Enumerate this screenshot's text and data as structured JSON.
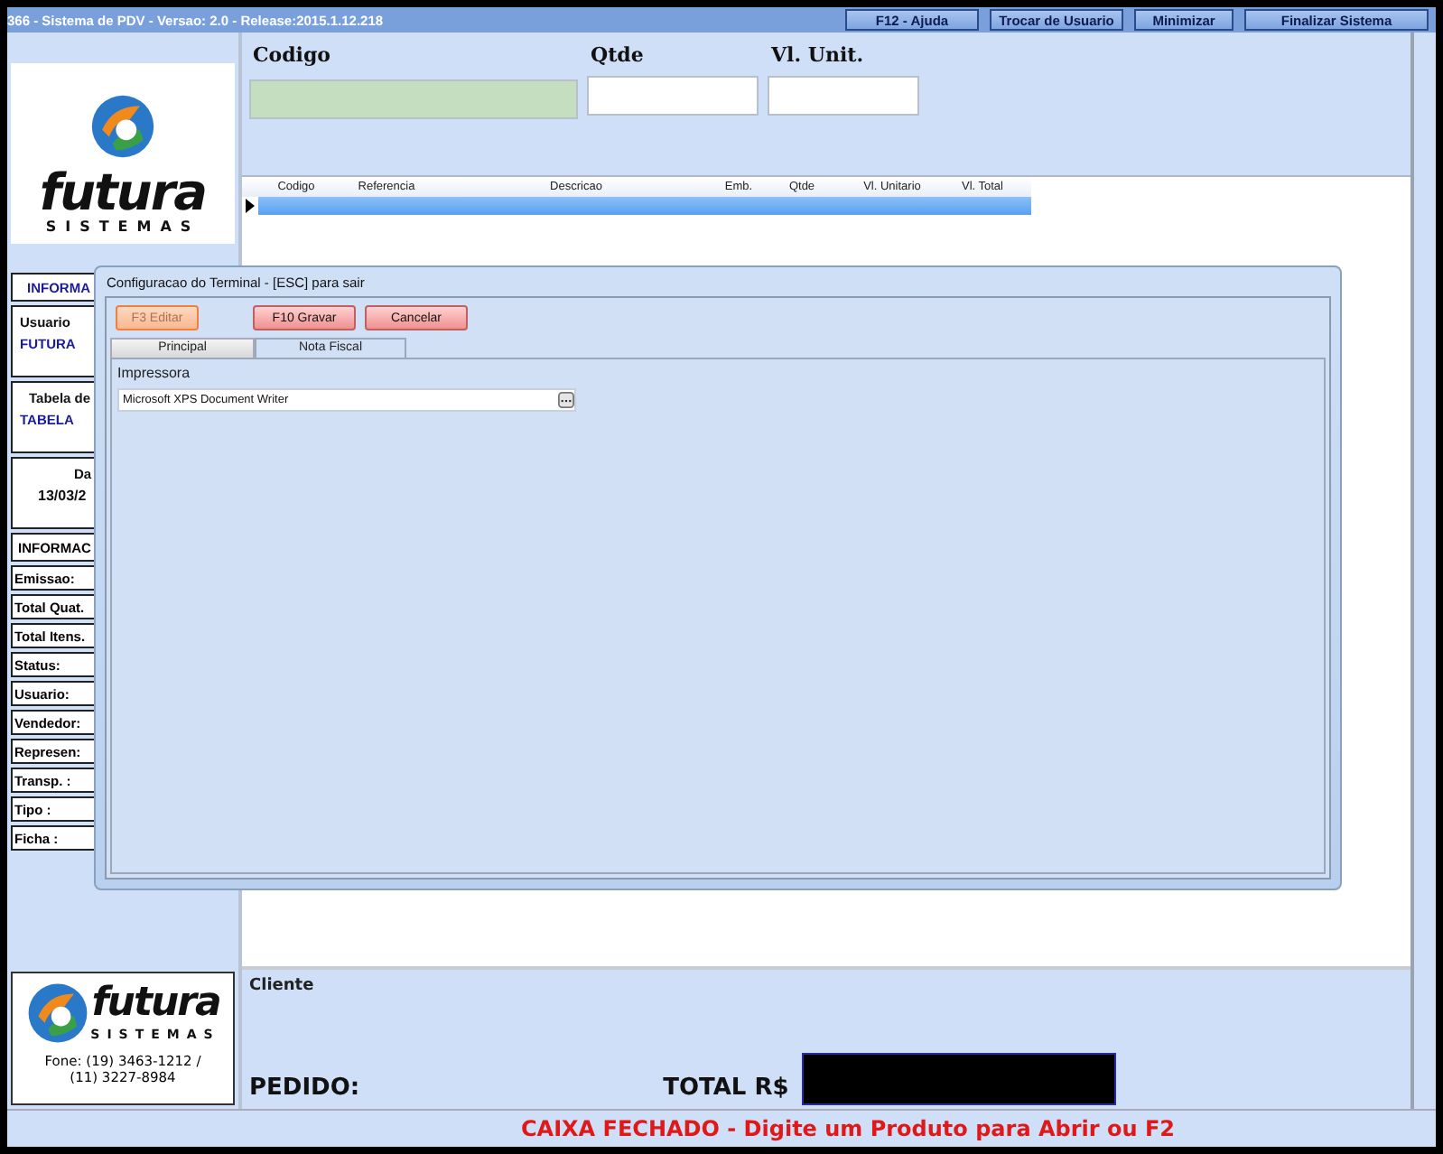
{
  "window": {
    "title": "366 - Sistema de PDV - Versao: 2.0 - Release:2015.1.12.218",
    "buttons": [
      "F12 - Ajuda",
      "Trocar de Usuario",
      "Minimizar",
      "Finalizar Sistema"
    ]
  },
  "sidebar": {
    "logo": {
      "name": "futura",
      "tagline": "SISTEMAS"
    },
    "info_header": "INFORMA",
    "user": {
      "label": "Usuario",
      "value": "FUTURA"
    },
    "price_table": {
      "label": "Tabela de",
      "value": "TABELA"
    },
    "date": {
      "label": "Da",
      "value": "13/03/2"
    },
    "info_header_2": "INFORMAC",
    "fields": [
      "Emissao:",
      "Total Quat.",
      "Total Itens.",
      "Status:",
      "Usuario:",
      "Vendedor:",
      "Represen:",
      "Transp. :",
      "Tipo :",
      "Ficha :"
    ],
    "bottom_logo": {
      "name": "futura",
      "tagline": "SISTEMAS",
      "phone": "Fone: (19) 3463-1212 / (11) 3227-8984"
    }
  },
  "entry": {
    "code_label": "Codigo",
    "qty_label": "Qtde",
    "unit_label": "Vl. Unit."
  },
  "table": {
    "columns": [
      "Codigo",
      "Referencia",
      "Descricao",
      "Emb.",
      "Qtde",
      "Vl. Unitario",
      "Vl. Total"
    ]
  },
  "footer": {
    "client_label": "Cliente",
    "order_label": "PEDIDO:",
    "total_label": "TOTAL R$"
  },
  "status_bar": "CAIXA FECHADO - Digite um Produto para Abrir ou F2",
  "dialog": {
    "title": "Configuracao do Terminal - [ESC] para sair",
    "buttons": [
      {
        "label": "F3 Editar",
        "disabled": true
      },
      {
        "label": "F10 Gravar",
        "disabled": false
      },
      {
        "label": "Cancelar",
        "disabled": false
      }
    ],
    "tabs": [
      {
        "label": "Principal",
        "selected": false
      },
      {
        "label": "Nota Fiscal",
        "selected": true
      }
    ],
    "printer_label": "Impressora",
    "printer_value": "Microsoft XPS Document Writer"
  }
}
